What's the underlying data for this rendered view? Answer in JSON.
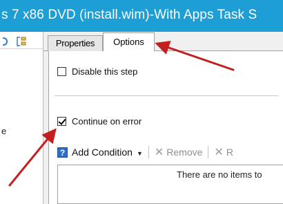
{
  "window": {
    "title": "s 7 x86 DVD (install.wim)-With Apps Task S"
  },
  "left_pane": {
    "partial_label": "e"
  },
  "tabs": [
    {
      "label": "Properties",
      "selected": false
    },
    {
      "label": "Options",
      "selected": true
    }
  ],
  "options": {
    "disable_step": {
      "label": "Disable this step",
      "checked": false
    },
    "continue_on_error": {
      "label": "Continue on error",
      "checked": true
    }
  },
  "conditions_toolbar": {
    "add_condition_label": "Add Condition",
    "remove_label": "Remove",
    "third_label": "R"
  },
  "conditions_list": {
    "empty_message": "There are no items to"
  },
  "colors": {
    "titlebar": "#1d9fd6",
    "annotation_arrow": "#c41e1e"
  }
}
